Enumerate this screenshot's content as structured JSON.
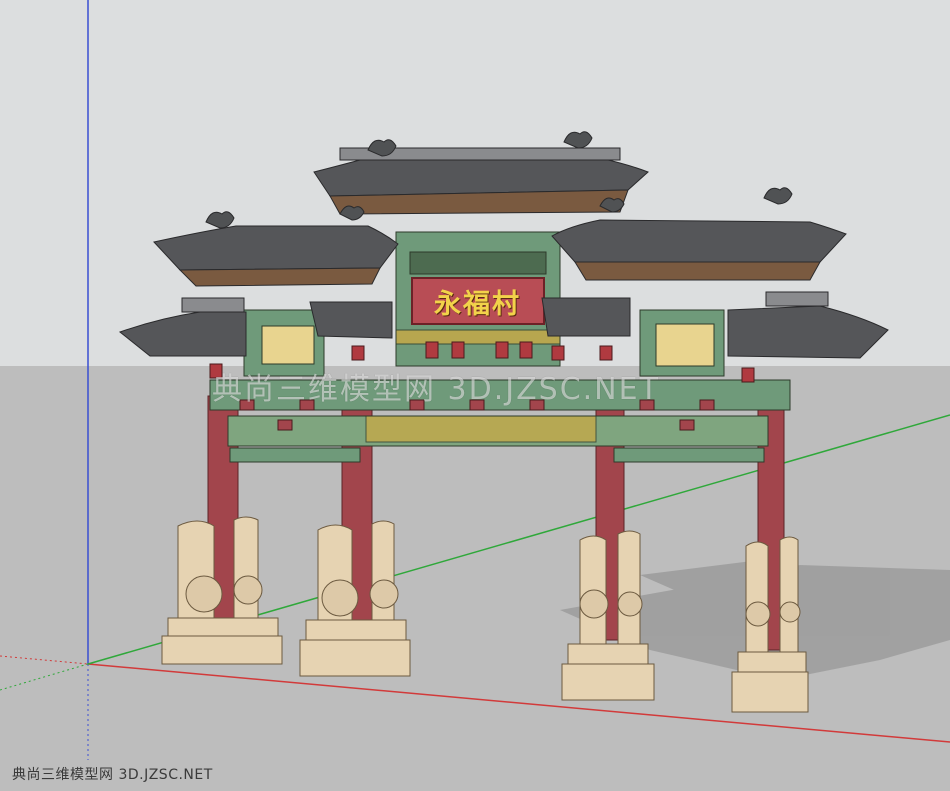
{
  "scene": {
    "plaque_text": "永福村",
    "watermark_overlay": "典尚三维模型网 3D.JZSC.NET",
    "watermark_footer": "典尚三维模型网 3D.JZSC.NET"
  },
  "colors": {
    "sky": "#dcdedf",
    "ground": "#bdbdbd",
    "roof": "#555659",
    "roof_edge": "#8a8b8e",
    "pillar": "#a2454c",
    "base_stone": "#e6d3b2",
    "beam_green": "#6f9a7a",
    "beam_gold": "#c9a945",
    "plaque": "#b84d55",
    "axis_red": "#d23a3a",
    "axis_green": "#2fa83a",
    "axis_blue": "#3a4fd2"
  },
  "icons": {
    "roof_ornament": "dragon-ornament-icon"
  }
}
